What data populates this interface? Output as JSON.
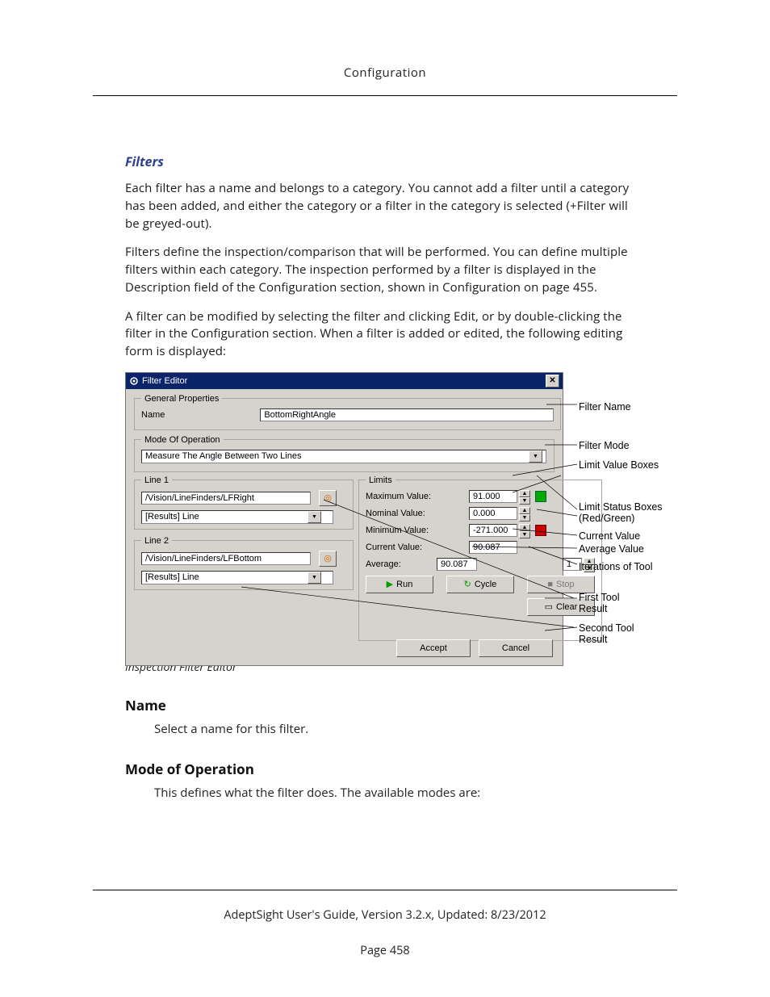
{
  "header": {
    "title": "Configuration"
  },
  "sections": {
    "filters_heading": "Filters",
    "p1": "Each filter has a name and belongs to a category. You cannot add a filter until a category has been added, and either the category or a filter in the category is selected (+Filter will be greyed-out).",
    "p2": "Filters define the inspection/comparison that will be performed. You can define multiple filters within each category. The inspection performed by a filter is displayed in the Description field of the Configuration section, shown in Configuration on page 455.",
    "p3": "A filter can be modified by selecting the filter and clicking Edit, or by double-clicking the filter in the Configuration section. When a filter is added or edited, the following editing form is displayed:"
  },
  "dialog": {
    "title": "Filter Editor",
    "generalProperties": {
      "legend": "General Properties",
      "nameLabel": "Name",
      "nameValue": "BottomRightAngle"
    },
    "modeOfOperation": {
      "legend": "Mode Of Operation",
      "value": "Measure The Angle Between Two Lines"
    },
    "line1": {
      "legend": "Line 1",
      "path": "/Vision/LineFinders/LFRight",
      "selectValue": "[Results] Line"
    },
    "line2": {
      "legend": "Line 2",
      "path": "/Vision/LineFinders/LFBottom",
      "selectValue": "[Results] Line"
    },
    "limits": {
      "legend": "Limits",
      "maxLabel": "Maximum Value:",
      "maxValue": "91.000",
      "nomLabel": "Nominal Value:",
      "nomValue": "0.000",
      "minLabel": "Minimum Value:",
      "minValue": "-271.000",
      "curLabel": "Current Value:",
      "curValue": "90.087",
      "avgLabel": "Average:",
      "avgValue": "90.087",
      "iterValue": "1",
      "runLabel": "Run",
      "cycleLabel": "Cycle",
      "stopLabel": "Stop",
      "clearLabel": "Clear"
    },
    "footer": {
      "accept": "Accept",
      "cancel": "Cancel"
    }
  },
  "annotations": {
    "filterName": "Filter Name",
    "filterMode": "Filter Mode",
    "limitValueBoxes": "Limit Value Boxes",
    "limitStatusBoxes": "Limit Status Boxes\n(Red/Green)",
    "currentValue": "Current Value",
    "averageValue": "Average Value",
    "iterations": "Iterations of Tool",
    "firstTool": "First Tool\nResult",
    "secondTool": "Second Tool\nResult"
  },
  "caption": "Inspection Filter Editor",
  "post": {
    "name_h": "Name",
    "name_p": "Select a name for this filter.",
    "mode_h": "Mode of Operation",
    "mode_p": "This defines what the filter does. The available modes are:"
  },
  "footer": {
    "line": "AdeptSight User's Guide,  Version 3.2.x, Updated: 8/23/2012",
    "page": "Page 458"
  }
}
